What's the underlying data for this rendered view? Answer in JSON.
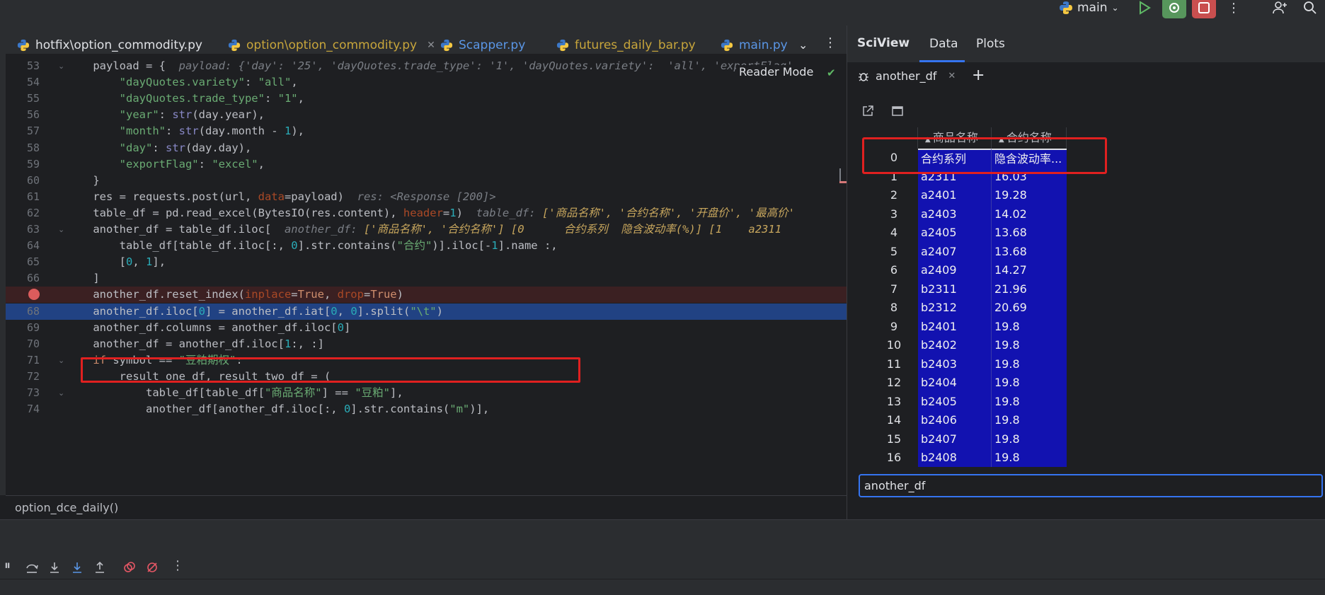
{
  "run_config": {
    "name": "main"
  },
  "editor_tabs": [
    {
      "label": "hotfix\\option_commodity.py",
      "color": "#dfe1e5",
      "active": false
    },
    {
      "label": "option\\option_commodity.py",
      "color": "#c7a53b",
      "active": true
    },
    {
      "label": "Scapper.py",
      "color": "#5a96e6",
      "active": false
    },
    {
      "label": "futures_daily_bar.py",
      "color": "#c7a53b",
      "active": false
    },
    {
      "label": "main.py",
      "color": "#5a96e6",
      "active": false
    }
  ],
  "editor": {
    "reader_mode": "Reader Mode",
    "lines": [
      {
        "no": "53",
        "code_parts": [
          [
            "",
            "    payload = {  "
          ],
          [
            "hint",
            "payload: {'day': '25', 'dayQuotes.trade_type': '1', 'dayQuotes.variety':  'all', 'exportFlag'"
          ]
        ]
      },
      {
        "no": "54",
        "code_parts": [
          [
            "",
            "        "
          ],
          [
            "str",
            "\"dayQuotes.variety\""
          ],
          [
            "",
            ": "
          ],
          [
            "str",
            "\"all\""
          ],
          [
            "",
            ","
          ]
        ]
      },
      {
        "no": "55",
        "code_parts": [
          [
            "",
            "        "
          ],
          [
            "str",
            "\"dayQuotes.trade_type\""
          ],
          [
            "",
            ": "
          ],
          [
            "str",
            "\"1\""
          ],
          [
            "",
            ","
          ]
        ]
      },
      {
        "no": "56",
        "code_parts": [
          [
            "",
            "        "
          ],
          [
            "str",
            "\"year\""
          ],
          [
            "",
            ": "
          ],
          [
            "bi",
            "str"
          ],
          [
            "",
            "(day.year),"
          ]
        ]
      },
      {
        "no": "57",
        "code_parts": [
          [
            "",
            "        "
          ],
          [
            "str",
            "\"month\""
          ],
          [
            "",
            ": "
          ],
          [
            "bi",
            "str"
          ],
          [
            "",
            "(day.month - "
          ],
          [
            "num",
            "1"
          ],
          [
            "",
            "),"
          ]
        ]
      },
      {
        "no": "58",
        "code_parts": [
          [
            "",
            "        "
          ],
          [
            "str",
            "\"day\""
          ],
          [
            "",
            ": "
          ],
          [
            "bi",
            "str"
          ],
          [
            "",
            "(day.day),"
          ]
        ]
      },
      {
        "no": "59",
        "code_parts": [
          [
            "",
            "        "
          ],
          [
            "str",
            "\"exportFlag\""
          ],
          [
            "",
            ": "
          ],
          [
            "str",
            "\"excel\""
          ],
          [
            "",
            ","
          ]
        ]
      },
      {
        "no": "60",
        "code_parts": [
          [
            "",
            "    }"
          ]
        ]
      },
      {
        "no": "61",
        "code_parts": [
          [
            "",
            "    res = requests.post(url, "
          ],
          [
            "param",
            "data"
          ],
          [
            "",
            "=payload)  "
          ],
          [
            "hint",
            "res: <Response [200]>"
          ]
        ]
      },
      {
        "no": "62",
        "code_parts": [
          [
            "",
            "    table_df = pd.read_excel(BytesIO(res.content), "
          ],
          [
            "param",
            "header"
          ],
          [
            "",
            "="
          ],
          [
            "num",
            "1"
          ],
          [
            "",
            ")  "
          ],
          [
            "hint",
            "table_df: "
          ],
          [
            "hint-code",
            "['商品名称', '合约名称', '开盘价', '最高价'"
          ]
        ]
      },
      {
        "no": "63",
        "code_parts": [
          [
            "",
            "    another_df = table_df.iloc[  "
          ],
          [
            "hint",
            "another_df: "
          ],
          [
            "hint-code",
            "['商品名称', '合约名称'] [0      合约系列  隐含波动率(%)] [1    a2311"
          ]
        ]
      },
      {
        "no": "64",
        "code_parts": [
          [
            "",
            "        table_df[table_df.iloc[:, "
          ],
          [
            "num",
            "0"
          ],
          [
            "",
            "].str.contains("
          ],
          [
            "str",
            "\"合约\""
          ],
          [
            "",
            ")].iloc[-"
          ],
          [
            "num",
            "1"
          ],
          [
            "",
            "].name :,"
          ]
        ]
      },
      {
        "no": "65",
        "code_parts": [
          [
            "",
            "        ["
          ],
          [
            "num",
            "0"
          ],
          [
            "",
            ", "
          ],
          [
            "num",
            "1"
          ],
          [
            "",
            "],"
          ]
        ]
      },
      {
        "no": "66",
        "code_parts": [
          [
            "",
            "    ]"
          ]
        ]
      },
      {
        "no": "",
        "code_parts": [
          [
            "",
            "    another_df.reset_index("
          ],
          [
            "param",
            "inplace"
          ],
          [
            "",
            "="
          ],
          [
            "kw",
            "True"
          ],
          [
            "",
            ", "
          ],
          [
            "param",
            "drop"
          ],
          [
            "",
            "="
          ],
          [
            "kw",
            "True"
          ],
          [
            "",
            ")"
          ]
        ]
      },
      {
        "no": "68",
        "code_parts": [
          [
            "",
            "    another_df.iloc["
          ],
          [
            "num",
            "0"
          ],
          [
            "",
            "] = another_df.iat["
          ],
          [
            "num",
            "0"
          ],
          [
            "",
            ", "
          ],
          [
            "num",
            "0"
          ],
          [
            "",
            "].split("
          ],
          [
            "str",
            "\"\\t\""
          ],
          [
            "",
            ")"
          ]
        ]
      },
      {
        "no": "69",
        "code_parts": [
          [
            "",
            "    another_df.columns = another_df.iloc["
          ],
          [
            "num",
            "0"
          ],
          [
            "",
            "]"
          ]
        ]
      },
      {
        "no": "70",
        "code_parts": [
          [
            "",
            "    another_df = another_df.iloc["
          ],
          [
            "num",
            "1"
          ],
          [
            "",
            ":, :]"
          ]
        ]
      },
      {
        "no": "71",
        "code_parts": [
          [
            "",
            "    "
          ],
          [
            "kw",
            "if"
          ],
          [
            "",
            " symbol == "
          ],
          [
            "str",
            "\"豆粕期权\""
          ],
          [
            "",
            ":"
          ]
        ]
      },
      {
        "no": "72",
        "code_parts": [
          [
            "",
            "        result_one_df, result_two_df = ("
          ]
        ]
      },
      {
        "no": "73",
        "code_parts": [
          [
            "",
            "            table_df[table_df["
          ],
          [
            "str",
            "\"商品名称\""
          ],
          [
            "",
            "] == "
          ],
          [
            "str",
            "\"豆粕\""
          ],
          [
            "",
            "],"
          ]
        ]
      },
      {
        "no": "74",
        "code_parts": [
          [
            "",
            "            another_df[another_df.iloc[:, "
          ],
          [
            "num",
            "0"
          ],
          [
            "",
            "].str.contains("
          ],
          [
            "str",
            "\"m\""
          ],
          [
            "",
            ")],"
          ]
        ]
      }
    ]
  },
  "breadcrumb": "option_dce_daily()",
  "sciview": {
    "title": "SciView",
    "tabs": [
      "Data",
      "Plots"
    ],
    "df_tab": "another_df",
    "columns": [
      "商品名称",
      "合约名称"
    ],
    "rows": [
      [
        "0",
        "合约系列",
        "隐含波动率..."
      ],
      [
        "1",
        "a2311",
        "16.03"
      ],
      [
        "2",
        "a2401",
        "19.28"
      ],
      [
        "3",
        "a2403",
        "14.02"
      ],
      [
        "4",
        "a2405",
        "13.68"
      ],
      [
        "5",
        "a2407",
        "13.68"
      ],
      [
        "6",
        "a2409",
        "14.27"
      ],
      [
        "7",
        "b2311",
        "21.96"
      ],
      [
        "8",
        "b2312",
        "20.69"
      ],
      [
        "9",
        "b2401",
        "19.8"
      ],
      [
        "10",
        "b2402",
        "19.8"
      ],
      [
        "11",
        "b2403",
        "19.8"
      ],
      [
        "12",
        "b2404",
        "19.8"
      ],
      [
        "13",
        "b2405",
        "19.8"
      ],
      [
        "14",
        "b2406",
        "19.8"
      ],
      [
        "15",
        "b2407",
        "19.8"
      ],
      [
        "16",
        "b2408",
        "19.8"
      ]
    ],
    "console_value": "another_df"
  },
  "colors": {
    "exec_line": "#214283",
    "breakpoint": "#db5c5c",
    "cell_bg": "#1212b0",
    "highlight_box": "#e02020"
  }
}
